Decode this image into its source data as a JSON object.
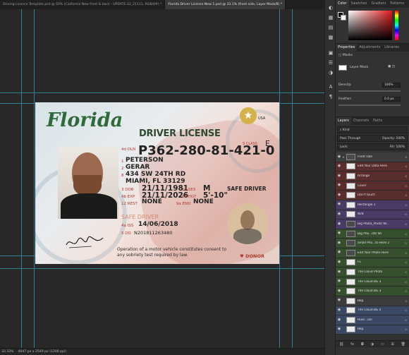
{
  "tabs": [
    {
      "label": "Driving Licence Template.psd @ 50% (California New front & back - UPDATE-22_21111, RGB/8#) *",
      "active": false
    },
    {
      "label": "Florida Driver License New 1.psd @ 33.1% (front side, Layer Mask/8) *",
      "active": true
    }
  ],
  "status": {
    "zoom": "33.33%",
    "doc_info": "4047 px x 2549 px (1200 ppi)"
  },
  "license": {
    "state": "Florida",
    "badge_label": "USA",
    "title": "DRIVER LICENSE",
    "class_label": "9 CLASS",
    "class_value": "E",
    "dln_label": "4d DLN",
    "dln_value": "P362-280-81-421-0",
    "name_num_1": "1",
    "last_name": "PETERSON",
    "name_num_2": "2",
    "first_name": "GERAR",
    "addr_num": "8",
    "address_1": "434 SW 24TH RD",
    "address_2": "MIAMI, FL 33129",
    "dob_label": "3 DOB",
    "dob": "21/11/1981",
    "sex_label": "15 SEX",
    "sex": "M",
    "exp_label": "4b EXP",
    "exp": "21/11/2026",
    "hgt_label": "16 HGT",
    "hgt": "5'-10\"",
    "rest_label": "12 REST",
    "rest": "NONE",
    "end_label": "9a END",
    "end": "NONE",
    "safe_driver_1": "SAFE DRIVER",
    "safe_driver_2": "SAFE DRIVER",
    "iss_label": "4a ISS",
    "iss": "14/06/2018",
    "dd_label": "5 DD",
    "dd": "N201811263480",
    "footer": "Operation of a motor vehicle constitutes consent to any sobriety test required by law.",
    "donor": "DONOR"
  },
  "right_strip": {
    "icons": [
      "color-icon",
      "swatches-icon",
      "gradients-icon",
      "patterns-icon",
      "libraries-icon",
      "properties-icon",
      "adjustments-icon",
      "type-icon",
      "paragraph-icon"
    ]
  },
  "color_panel": {
    "tabs": [
      "Color",
      "Swatches",
      "Gradient",
      "Patterns"
    ],
    "accent": "#e21a1a"
  },
  "properties_panel": {
    "tabs": [
      "Properties",
      "Adjustments",
      "Libraries"
    ],
    "section": "Masks",
    "mask_label": "Layer Mask",
    "density_label": "Density:",
    "density_value": "100%",
    "feather_label": "Feather:",
    "feather_value": "0.0 px"
  },
  "layers_panel": {
    "tabs": [
      "Layers",
      "Channels",
      "Paths"
    ],
    "filter_kind": "Kind",
    "blend_mode": "Pass Through",
    "opacity_label": "Opacity:",
    "opacity_value": "100%",
    "lock_label": "Lock:",
    "fill_label": "Fill:",
    "fill_value": "100%",
    "layers": [
      {
        "name": "Front side",
        "color": "gray",
        "thumb": "dark"
      },
      {
        "name": "Edit Your Data Here",
        "color": "red",
        "thumb": "light"
      },
      {
        "name": "Arrange",
        "color": "red",
        "thumb": "light"
      },
      {
        "name": "Cover",
        "color": "red",
        "thumb": "light"
      },
      {
        "name": "Don't touch",
        "color": "red",
        "thumb": "light"
      },
      {
        "name": "Rectangle 1",
        "color": "purple",
        "thumb": "light"
      },
      {
        "name": "W/B",
        "color": "purple",
        "thumb": "light"
      },
      {
        "name": "Big Photo_Photo Wi...",
        "color": "purple",
        "thumb": "dark"
      },
      {
        "name": "Big Pho...oto WI",
        "color": "green",
        "thumb": "dark"
      },
      {
        "name": "Small Pho...to Here 2",
        "color": "green",
        "thumb": "dark"
      },
      {
        "name": "Edit Your Photo Here",
        "color": "green",
        "thumb": "dark"
      },
      {
        "name": "FL",
        "color": "green",
        "thumb": "light"
      },
      {
        "name": "The Cloud Photo",
        "color": "green",
        "thumb": "light"
      },
      {
        "name": "The Cloud BG 3",
        "color": "green",
        "thumb": "light"
      },
      {
        "name": "The Cloud BG 3",
        "color": "green",
        "thumb": "light"
      },
      {
        "name": "Bkg",
        "color": "gray",
        "thumb": "light"
      },
      {
        "name": "The Cloud BG 4",
        "color": "blue",
        "thumb": "light"
      },
      {
        "name": "Hue/...ion",
        "color": "blue",
        "thumb": "light"
      },
      {
        "name": "Bkg",
        "color": "blue",
        "thumb": "light"
      }
    ],
    "bottom_icons": [
      "link-icon",
      "fx-icon",
      "mask-icon",
      "adjustment-icon",
      "folder-icon",
      "new-layer-icon",
      "trash-icon"
    ]
  }
}
